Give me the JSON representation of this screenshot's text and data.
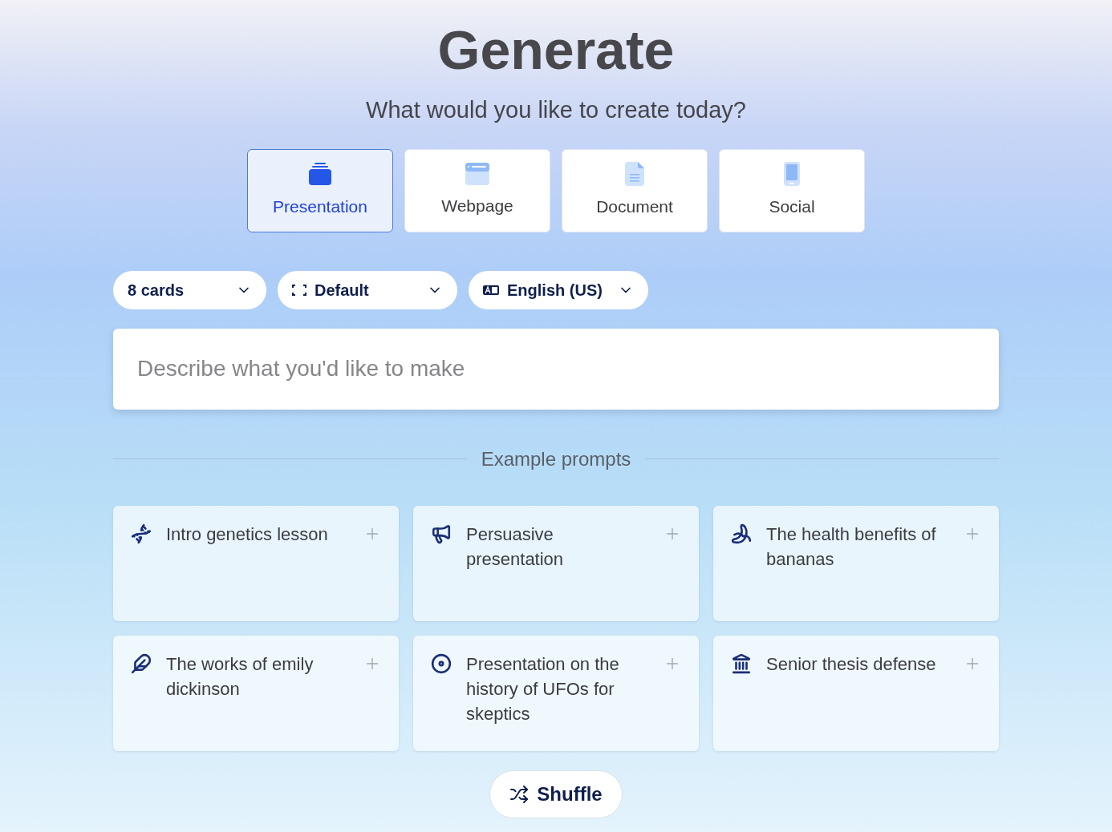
{
  "title": "Generate",
  "subtitle": "What would you like to create today?",
  "types": [
    {
      "label": "Presentation",
      "selected": true
    },
    {
      "label": "Webpage",
      "selected": false
    },
    {
      "label": "Document",
      "selected": false
    },
    {
      "label": "Social",
      "selected": false
    }
  ],
  "options": [
    {
      "value": "8 cards"
    },
    {
      "value": "Default"
    },
    {
      "value": "English (US)"
    }
  ],
  "prompt_field": {
    "placeholder": "Describe what you'd like to make"
  },
  "examples_heading": "Example prompts",
  "examples": [
    {
      "text": "Intro genetics lesson"
    },
    {
      "text": "Persuasive presentation"
    },
    {
      "text": "The health benefits of bananas"
    },
    {
      "text": "The works of emily dickinson"
    },
    {
      "text": "Presentation on the history of UFOs for skeptics"
    },
    {
      "text": "Senior thesis defense"
    }
  ],
  "shuffle": "Shuffle"
}
